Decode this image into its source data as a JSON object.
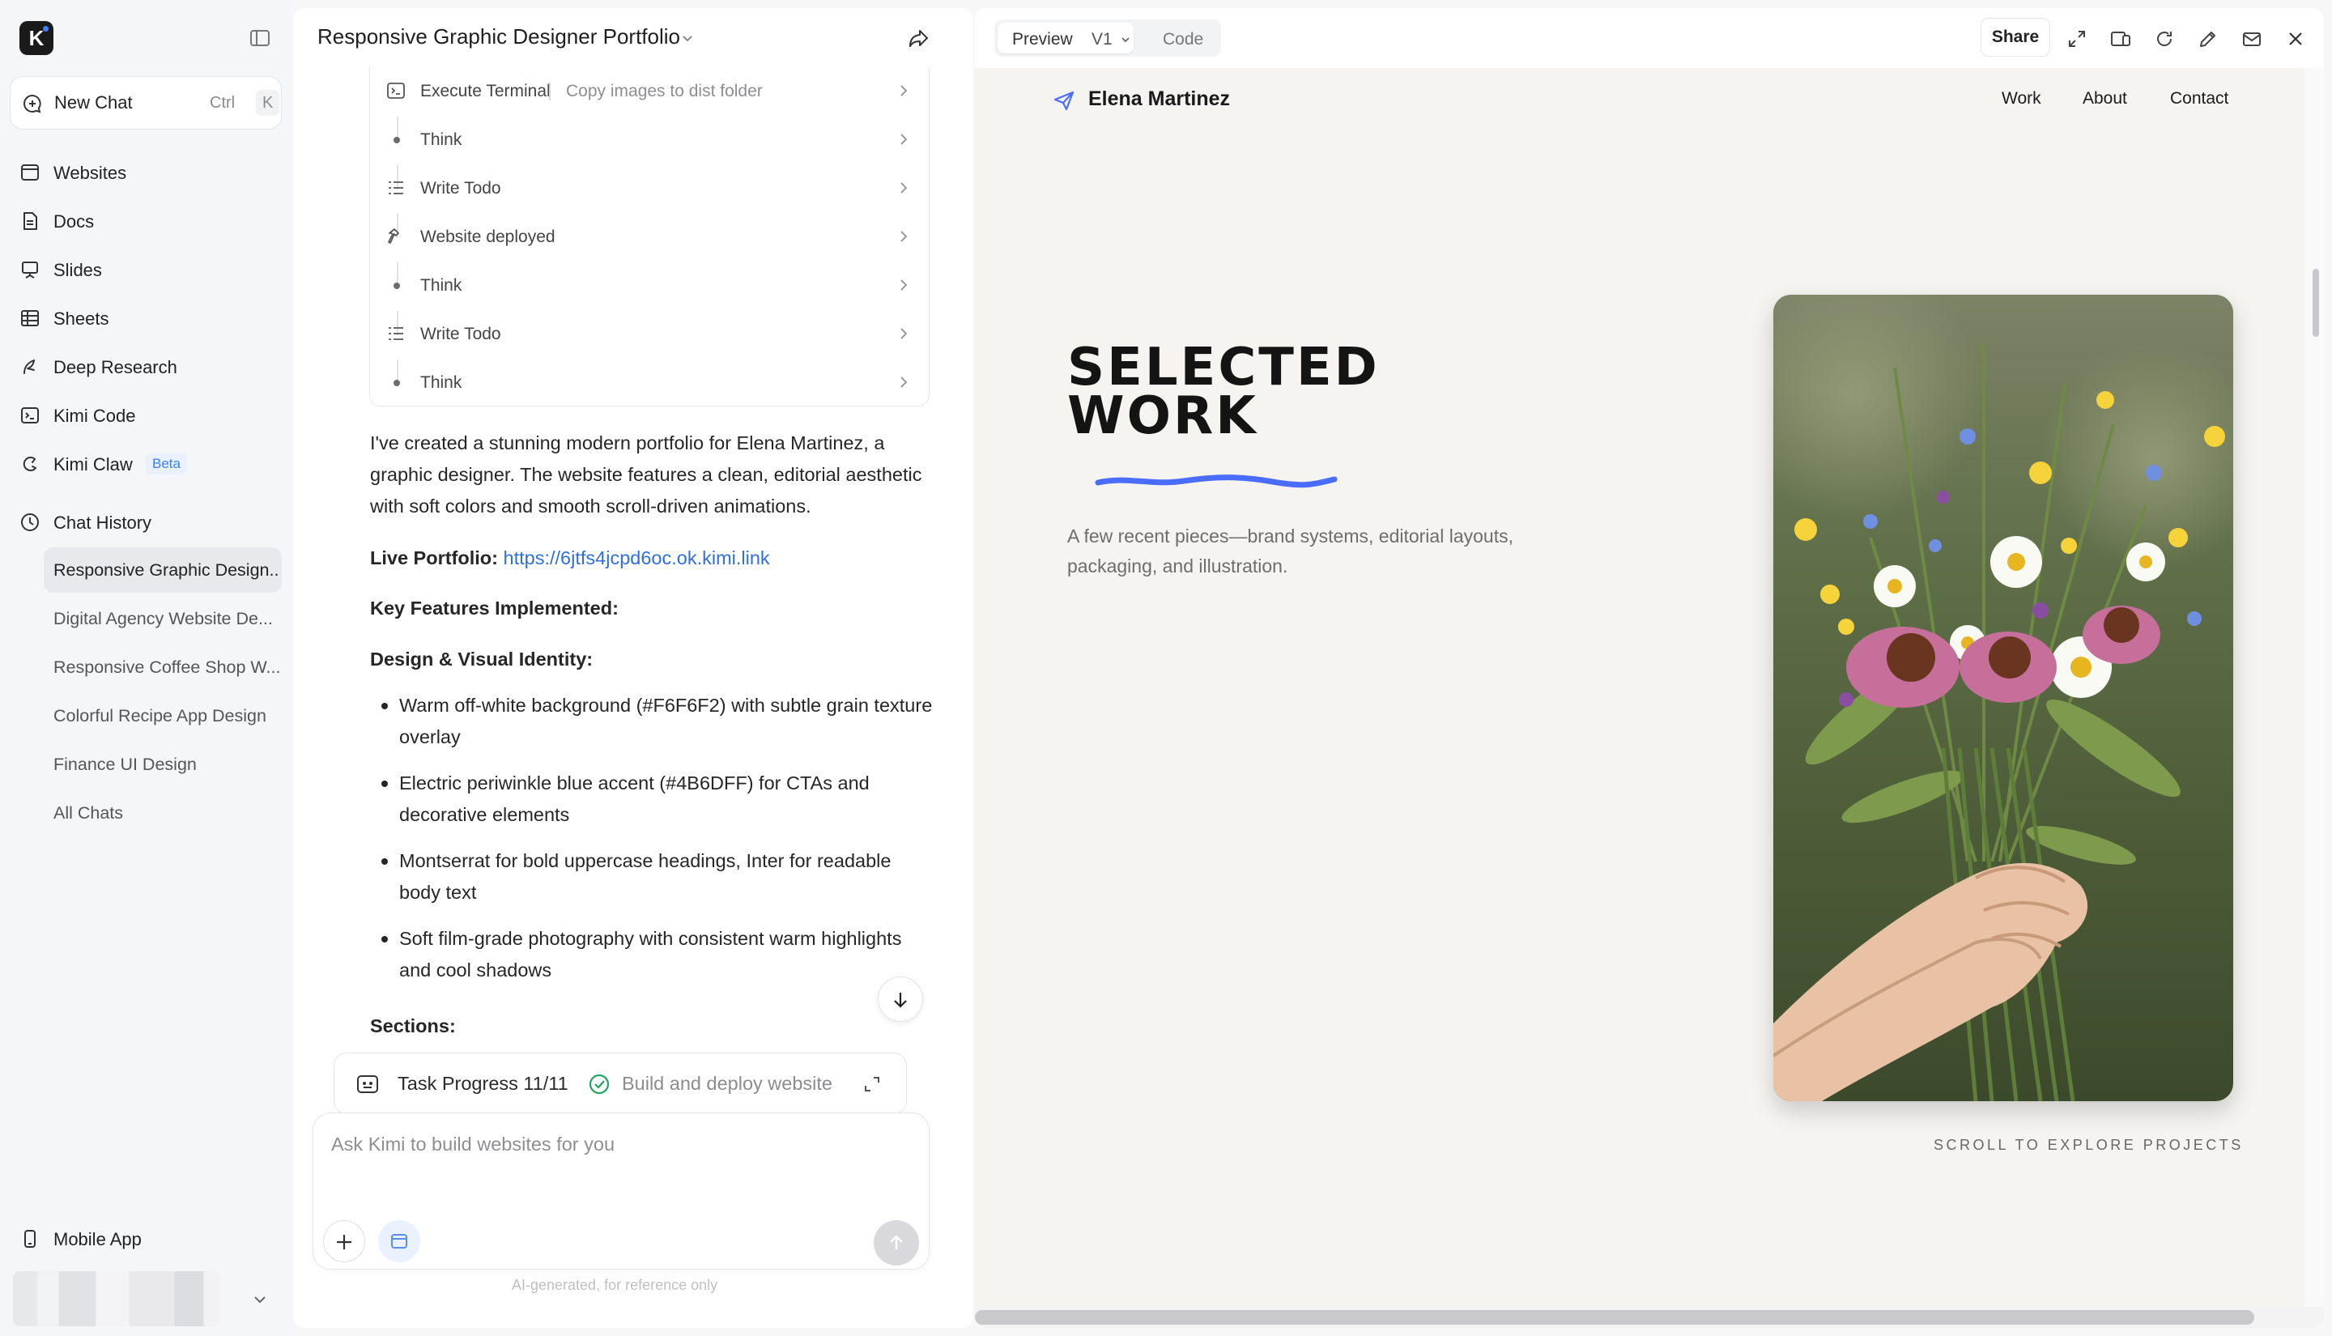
{
  "sidebar": {
    "logo_letter": "K",
    "new_chat": {
      "label": "New Chat",
      "shortcut_mod": "Ctrl",
      "shortcut_key": "K"
    },
    "nav": [
      {
        "label": "Websites",
        "icon": "browser-window-icon"
      },
      {
        "label": "Docs",
        "icon": "document-icon"
      },
      {
        "label": "Slides",
        "icon": "presentation-icon"
      },
      {
        "label": "Sheets",
        "icon": "table-grid-icon"
      },
      {
        "label": "Deep Research",
        "icon": "research-icon"
      },
      {
        "label": "Kimi Code",
        "icon": "terminal-icon"
      },
      {
        "label": "Kimi Claw",
        "icon": "claw-icon",
        "badge": "Beta"
      }
    ],
    "history_heading": "Chat History",
    "history": [
      {
        "label": "Responsive Graphic Design...",
        "active": true
      },
      {
        "label": "Digital Agency Website De...",
        "active": false
      },
      {
        "label": "Responsive Coffee Shop W...",
        "active": false
      },
      {
        "label": "Colorful Recipe App Design",
        "active": false
      },
      {
        "label": "Finance UI Design",
        "active": false
      },
      {
        "label": "All Chats",
        "active": false
      }
    ],
    "mobile_app": "Mobile App"
  },
  "chat": {
    "title": "Responsive Graphic Designer Portfolio",
    "steps": [
      {
        "label": "Execute Terminal",
        "detail": "Copy images to dist folder",
        "icon": "terminal-icon"
      },
      {
        "label": "Think",
        "icon": "dot"
      },
      {
        "label": "Write Todo",
        "icon": "checklist-icon"
      },
      {
        "label": "Website deployed",
        "icon": "hammer-icon"
      },
      {
        "label": "Think",
        "icon": "dot"
      },
      {
        "label": "Write Todo",
        "icon": "checklist-icon"
      },
      {
        "label": "Think",
        "icon": "dot"
      }
    ],
    "intro": "I've created a stunning modern portfolio for Elena Martinez, a graphic designer. The website features a clean, editorial aesthetic with soft colors and smooth scroll-driven animations.",
    "live_label": "Live Portfolio:",
    "live_url": "https://6jtfs4jcpd6oc.ok.kimi.link",
    "features_heading": "Key Features Implemented:",
    "design_heading": "Design & Visual Identity:",
    "bullets": [
      "Warm off-white background (#F6F6F2) with subtle grain texture overlay",
      "Electric periwinkle blue accent (#4B6DFF) for CTAs and decorative elements",
      "Montserrat for bold uppercase headings, Inter for readable body text",
      "Soft film-grade photography with consistent warm highlights and cool shadows"
    ],
    "sections_heading": "Sections:",
    "task_progress": {
      "label": "Task Progress 11/11",
      "status": "Build and deploy website"
    },
    "composer_placeholder": "Ask Kimi to build websites for you",
    "disclaimer": "AI-generated, for reference only"
  },
  "preview": {
    "tabs": {
      "preview": "Preview",
      "version": "V1",
      "code": "Code"
    },
    "share": "Share",
    "site": {
      "name": "Elena Martinez",
      "nav": [
        "Work",
        "About",
        "Contact"
      ],
      "hero_line1": "SELECTED",
      "hero_line2": "WORK",
      "subtitle": "A few recent pieces—brand systems, editorial layouts, packaging, and illustration.",
      "scroll_hint": "SCROLL TO EXPLORE PROJECTS",
      "accent": "#4B6DFF",
      "background": "#F6F6F2"
    }
  }
}
